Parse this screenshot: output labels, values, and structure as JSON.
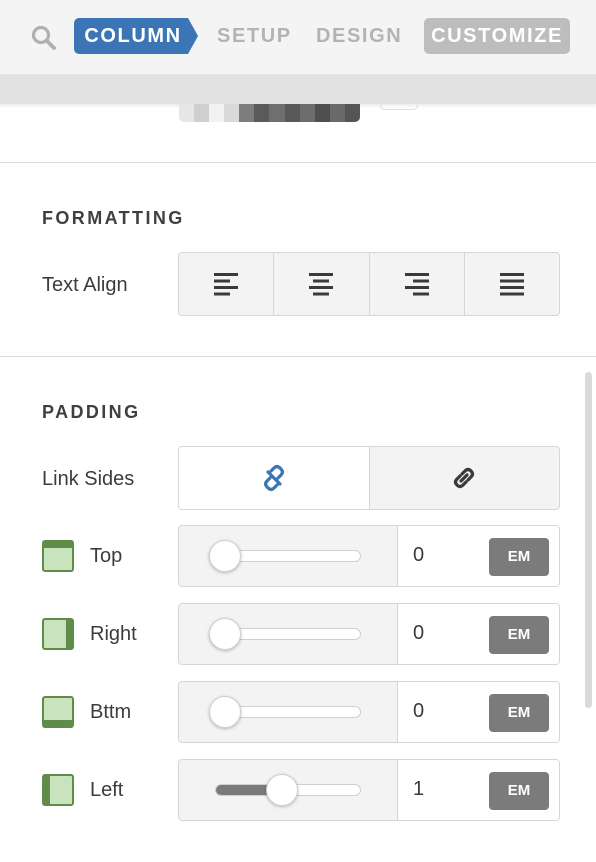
{
  "nav": {
    "tabs": [
      {
        "label": "COLUMN",
        "state": "active"
      },
      {
        "label": "SETUP",
        "state": "inactive"
      },
      {
        "label": "DESIGN",
        "state": "inactive"
      },
      {
        "label": "CUSTOMIZE",
        "state": "highlighted"
      }
    ],
    "search_icon": "search-icon",
    "accent_color": "#3b75b5"
  },
  "formatting": {
    "title": "FORMATTING",
    "text_align": {
      "label": "Text Align",
      "options": [
        "align-left-icon",
        "align-center-icon",
        "align-right-icon",
        "align-justify-icon"
      ]
    }
  },
  "padding": {
    "title": "PADDING",
    "link_sides": {
      "label": "Link Sides",
      "options": [
        "unlink-icon",
        "link-icon"
      ],
      "selected": "unlink-icon"
    },
    "sides": [
      {
        "label": "Top",
        "value": "0",
        "unit": "EM",
        "slider_fraction": 0.0,
        "icon": "padding-top-icon"
      },
      {
        "label": "Right",
        "value": "0",
        "unit": "EM",
        "slider_fraction": 0.0,
        "icon": "padding-right-icon"
      },
      {
        "label": "Bttm",
        "value": "0",
        "unit": "EM",
        "slider_fraction": 0.0,
        "icon": "padding-bottom-icon"
      },
      {
        "label": "Left",
        "value": "1",
        "unit": "EM",
        "slider_fraction": 0.45,
        "icon": "padding-left-icon"
      }
    ]
  }
}
